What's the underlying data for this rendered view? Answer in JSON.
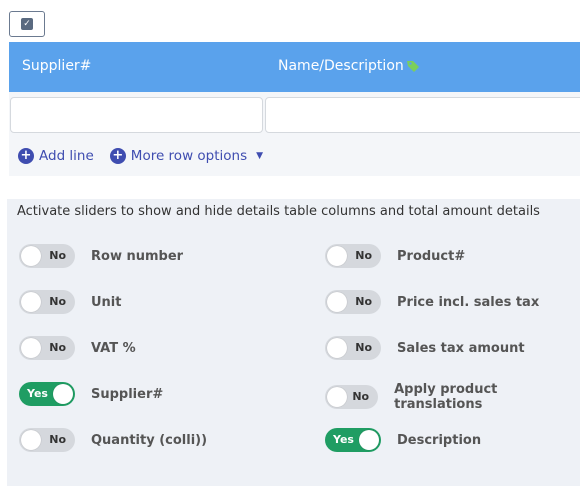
{
  "checkbox": {
    "icon": "checkbox-icon",
    "symbol": "✓"
  },
  "table": {
    "columns": [
      "Supplier#",
      "Name/Description"
    ],
    "name_icon": "tag-icon"
  },
  "row_actions": {
    "add_line": "Add line",
    "more_options": "More row options"
  },
  "panel": {
    "title": "Activate sliders to show and hide details table columns and total amount details",
    "left": [
      {
        "label": "Row number",
        "state": "No",
        "on": false
      },
      {
        "label": "Unit",
        "state": "No",
        "on": false
      },
      {
        "label": "VAT %",
        "state": "No",
        "on": false
      },
      {
        "label": "Supplier#",
        "state": "Yes",
        "on": true
      },
      {
        "label": "Quantity (colli))",
        "state": "No",
        "on": false
      }
    ],
    "right": [
      {
        "label": "Product#",
        "state": "No",
        "on": false
      },
      {
        "label": "Price incl. sales tax",
        "state": "No",
        "on": false
      },
      {
        "label": "Sales tax amount",
        "state": "No",
        "on": false
      },
      {
        "label": "Apply product translations",
        "state": "No",
        "on": false
      },
      {
        "label": "Description",
        "state": "Yes",
        "on": true
      }
    ]
  },
  "colors": {
    "header": "#5aa2ec",
    "accent": "#3f4db0",
    "toggle_on": "#1f9d63",
    "toggle_off": "#d5d8dd",
    "tag": "#7ccf5b"
  }
}
